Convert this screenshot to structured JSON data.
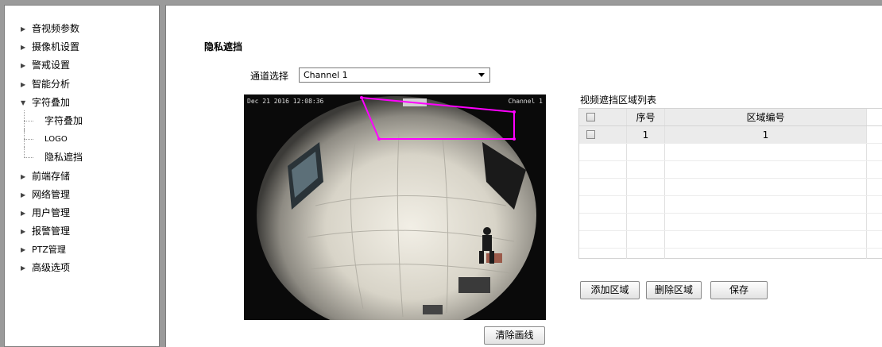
{
  "sidebar": {
    "items": [
      {
        "label": "音视频参数",
        "expanded": false
      },
      {
        "label": "摄像机设置",
        "expanded": false
      },
      {
        "label": "警戒设置",
        "expanded": false
      },
      {
        "label": "智能分析",
        "expanded": false
      },
      {
        "label": "字符叠加",
        "expanded": true
      },
      {
        "label": "前端存储",
        "expanded": false
      },
      {
        "label": "网络管理",
        "expanded": false
      },
      {
        "label": "用户管理",
        "expanded": false
      },
      {
        "label": "报警管理",
        "expanded": false
      },
      {
        "label": "PTZ管理",
        "expanded": false
      },
      {
        "label": "高级选项",
        "expanded": false
      }
    ],
    "subitems": [
      "字符叠加",
      "LOGO",
      "隐私遮挡"
    ]
  },
  "main": {
    "title": "隐私遮挡",
    "channel_label": "通道选择",
    "channel_value": "Channel 1",
    "osd_time": "Dec 21 2016 12:08:36",
    "osd_channel": "Channel 1",
    "clear_button": "清除画线",
    "list_title": "视频遮挡区域列表",
    "table": {
      "headers": [
        "序号",
        "区域编号"
      ],
      "rows": [
        [
          "1",
          "1"
        ]
      ]
    },
    "add_button": "添加区域",
    "delete_button": "删除区域",
    "save_button": "保存"
  },
  "colors": {
    "mask_outline": "#ff00ff",
    "video_bg": "#0a0a0a"
  }
}
